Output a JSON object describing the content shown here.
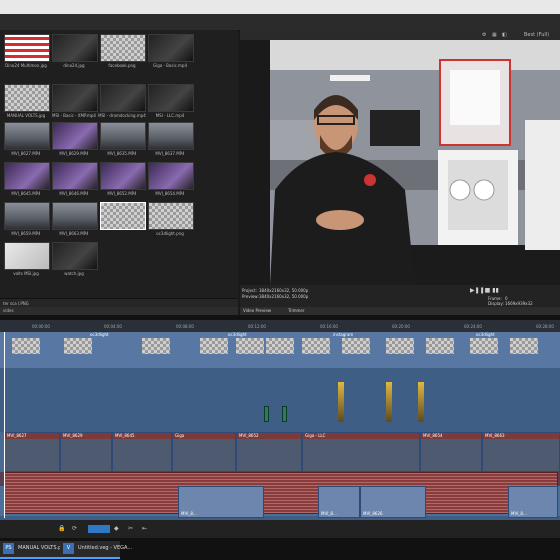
{
  "media": {
    "items": [
      {
        "label": "Dino24 Multimon.jpg",
        "style": "redlines"
      },
      {
        "label": "dino24.jpg",
        "style": "dark"
      },
      {
        "label": "facebook.png",
        "style": "checker"
      },
      {
        "label": "Giga - Basic.mp4",
        "style": "dark"
      },
      {
        "label": "MANUAL VOLTS.jpg",
        "style": "checker"
      },
      {
        "label": "MSI - Basic - XMP.mp4",
        "style": "dark"
      },
      {
        "label": "MSI - dramdocking.mp4",
        "style": "dark"
      },
      {
        "label": "MSI - LLC.mp4",
        "style": "dark"
      },
      {
        "label": "MVI_8627.MP4",
        "style": "room"
      },
      {
        "label": "MVI_8629.MP4",
        "style": "purple"
      },
      {
        "label": "MVI_8635.MP4",
        "style": "room"
      },
      {
        "label": "MVI_8637.MP4",
        "style": "room"
      },
      {
        "label": "MVI_8645.MP4",
        "style": "purple"
      },
      {
        "label": "MVI_8646.MP4",
        "style": "purple"
      },
      {
        "label": "MVI_8652.MP4",
        "style": "purple"
      },
      {
        "label": "MVI_8654.MP4",
        "style": "purple"
      },
      {
        "label": "MVI_8659.MP4",
        "style": "room"
      },
      {
        "label": "MVI_8663.MP4",
        "style": "room"
      },
      {
        "label": "",
        "style": "checker"
      },
      {
        "label": "oc3dlight.png",
        "style": "checker"
      },
      {
        "label": "volts MSI.jpg",
        "style": "white"
      },
      {
        "label": "watch.jpg",
        "style": "dark"
      }
    ],
    "path_text": "ter sca l.PNG",
    "tab_label": "vides"
  },
  "preview": {
    "quality": "Best (Full)",
    "project_label": "Project:",
    "project_value": "3840x2160x32, 50.000p",
    "preview_label": "Preview:",
    "preview_value": "3840x2160x32, 50.000p",
    "frame_label": "Frame:",
    "frame_value": "0",
    "display_label": "Display:",
    "display_value": "1669x939x32",
    "tab_video_preview": "Video Preview",
    "tab_trimmer": "Trimmer"
  },
  "timeline": {
    "ruler": [
      "00:00:00",
      "00:04:00",
      "00:08:00",
      "00:12:00",
      "00:16:00",
      "00:20:00",
      "00:24:00",
      "00:28:00"
    ],
    "markers": [
      "oc3dlight",
      "oc3dlight",
      "instagram",
      "oc3dlight"
    ],
    "video_clips": [
      {
        "label": "MVI_8627"
      },
      {
        "label": "MVI_8629"
      },
      {
        "label": "MVI_8645"
      },
      {
        "label": "Giga"
      },
      {
        "label": "MVI_8652"
      },
      {
        "label": "Giga - LLC"
      },
      {
        "label": "MVI_8654"
      },
      {
        "label": "MVI_8663"
      }
    ],
    "lower_clips": [
      {
        "label": "MVI_8..."
      },
      {
        "label": "MVI_8..."
      },
      {
        "label": "MVI_8626"
      },
      {
        "label": "MVI_8..."
      }
    ]
  },
  "taskbar": {
    "items": [
      {
        "icon": "PS",
        "label": "MANUAL VOLTS.png"
      },
      {
        "icon": "V",
        "label": "Untitled.veg - VEGA..."
      }
    ]
  }
}
